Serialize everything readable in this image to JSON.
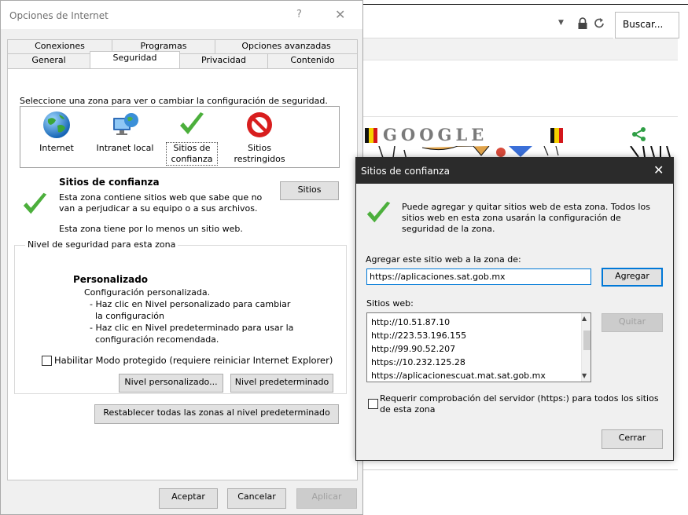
{
  "browser": {
    "search_placeholder": "Buscar...",
    "doodle_title": "GOOGLE"
  },
  "internet_options": {
    "title": "Opciones de Internet",
    "help": "?",
    "close": "✕",
    "tabs_back": [
      "Conexiones",
      "Programas",
      "Opciones avanzadas"
    ],
    "tabs_front": [
      "General",
      "Seguridad",
      "Privacidad",
      "Contenido"
    ],
    "zone_instruction": "Seleccione una zona para ver o cambiar la configuración de seguridad.",
    "zones": [
      {
        "label_1": "Internet",
        "label_2": "",
        "icon": "globe-icon"
      },
      {
        "label_1": "Intranet local",
        "label_2": "",
        "icon": "intranet-icon"
      },
      {
        "label_1": "Sitios de",
        "label_2": "confianza",
        "icon": "checkmark-icon"
      },
      {
        "label_1": "Sitios",
        "label_2": "restringidos",
        "icon": "restricted-icon"
      }
    ],
    "zone_name": "Sitios de confianza",
    "zone_desc": "Esta zona contiene sitios web que sabe que no van a perjudicar a su equipo o a sus archivos.",
    "zone_note": "Esta zona tiene por lo menos un sitio web.",
    "sites_button": "Sitios",
    "level_legend": "Nivel de seguridad para esta zona",
    "level_name": "Personalizado",
    "level_desc": "Configuración personalizada.\n  - Haz clic en Nivel personalizado para cambiar\n    la configuración\n  - Haz clic en Nivel predeterminado para usar la\n    configuración recomendada.",
    "protected_mode": "Habilitar Modo protegido (requiere reiniciar Internet Explorer)",
    "custom_level": "Nivel personalizado...",
    "default_level": "Nivel predeterminado",
    "reset_all": "Restablecer todas las zonas al nivel predeterminado",
    "ok": "Aceptar",
    "cancel": "Cancelar",
    "apply": "Aplicar"
  },
  "trusted_sites": {
    "title": "Sitios de confianza",
    "close": "✕",
    "description": "Puede agregar y quitar sitios web de esta zona. Todos los sitios web en esta zona usarán la configuración de seguridad de la zona.",
    "add_label": "Agregar este sitio web a la zona de:",
    "input_value": "https://aplicaciones.sat.gob.mx",
    "add_button": "Agregar",
    "websites_label": "Sitios web:",
    "sites": [
      "http://10.51.87.10",
      "http://223.53.196.155",
      "http://99.90.52.207",
      "https://10.232.125.28",
      "https://aplicacionescuat.mat.sat.gob.mx"
    ],
    "remove_button": "Quitar",
    "require_https": "Requerir comprobación del servidor (https:) para todos los sitios de esta zona",
    "close_button": "Cerrar"
  },
  "colors": {
    "accent": "#0078d7",
    "check_green": "#4caf3c",
    "restricted_red": "#d81e1e",
    "dark_title": "#2b2b2b"
  }
}
